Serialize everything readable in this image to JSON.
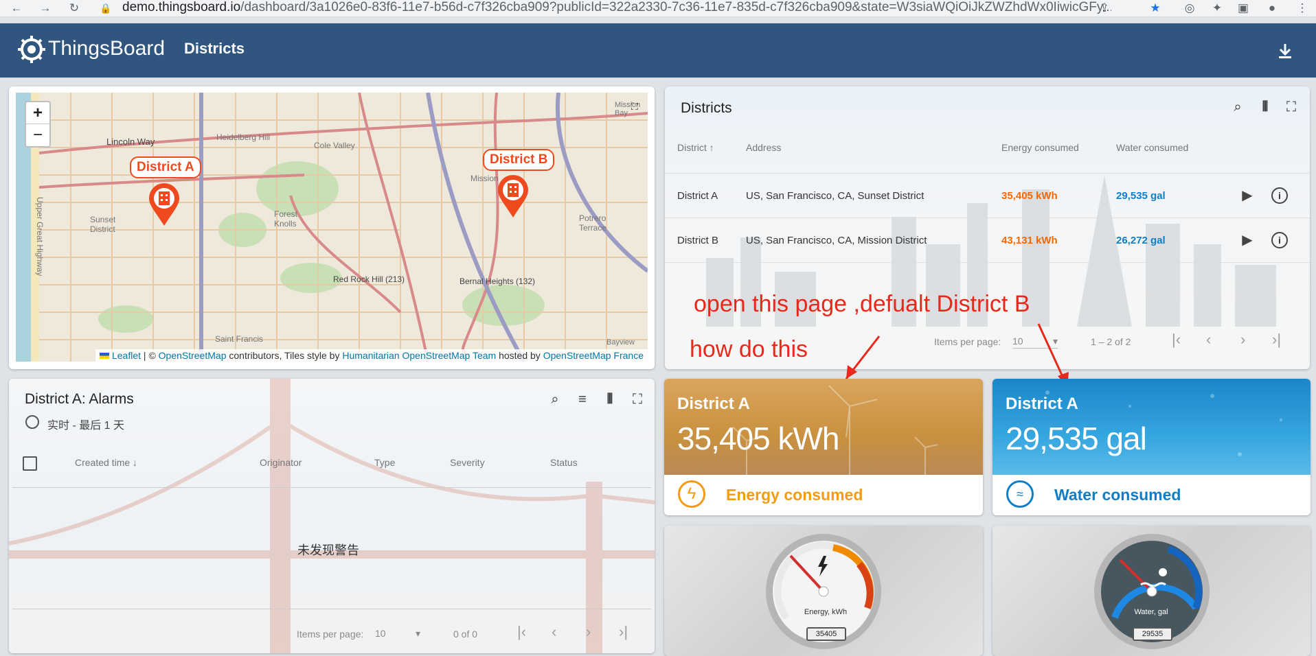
{
  "browser": {
    "url_host": "demo.thingsboard.io",
    "url_path": "/dashboard/3a1026e0-83f6-11e7-b56d-c7f326cba909?publicId=322a2330-7c36-11e7-835d-c7f326cba909&state=W3siaWQiOiJkZWZhdWx0IiwicGFy..."
  },
  "header": {
    "brand": "ThingsBoard",
    "title": "Districts"
  },
  "map": {
    "marker_a": "District A",
    "marker_b": "District B",
    "zoom_in": "+",
    "zoom_out": "−",
    "labels": {
      "lincoln": "Lincoln Way",
      "heidelberg": "Heidelberg Hill",
      "cole": "Cole Valley",
      "forest": "Forest Knolls",
      "sunset": "Sunset District",
      "redrock": "Red Rock Hill (213)",
      "bernal": "Bernal Heights (132)",
      "potrero": "Potrero Terrace",
      "mission": "Mission",
      "saintfrancis": "Saint Francis",
      "upper": "Upper Great Highway",
      "bayview": "Bayview",
      "missionbay": "Mission Bay"
    },
    "attr_leaflet": "Leaflet",
    "attr_sep1": " | © ",
    "attr_osm": "OpenStreetMap",
    "attr_mid": " contributors, Tiles style by ",
    "attr_hot": "Humanitarian OpenStreetMap Team",
    "attr_hosted": " hosted by ",
    "attr_fr": "OpenStreetMap France"
  },
  "districts": {
    "title": "Districts",
    "columns": {
      "district": "District",
      "address": "Address",
      "energy": "Energy consumed",
      "water": "Water consumed"
    },
    "rows": [
      {
        "district": "District A",
        "address": "US, San Francisco, CA, Sunset District",
        "energy": "35,405 kWh",
        "water": "29,535 gal"
      },
      {
        "district": "District B",
        "address": "US, San Francisco, CA, Mission District",
        "energy": "43,131 kWh",
        "water": "26,272 gal"
      }
    ],
    "items_per_page_label": "Items per page:",
    "items_per_page": "10",
    "range": "1 – 2 of 2"
  },
  "annotations": {
    "line1": "open this page  ,defualt District B",
    "line2": "how do this"
  },
  "alarms": {
    "title": "District A: Alarms",
    "timewindow": "实时 - 最后 1 天",
    "columns": {
      "created": "Created time",
      "originator": "Originator",
      "type": "Type",
      "severity": "Severity",
      "status": "Status"
    },
    "empty": "未发现警告",
    "items_per_page_label": "Items per page:",
    "items_per_page": "10",
    "range": "0 of 0"
  },
  "energy_tile": {
    "title": "District A",
    "value": "35,405 kWh",
    "label": "Energy consumed"
  },
  "water_tile": {
    "title": "District A",
    "value": "29,535 gal",
    "label": "Water consumed"
  },
  "energy_gauge": {
    "label": "Energy, kWh",
    "readout": "35405"
  },
  "water_gauge": {
    "label": "Water, gal",
    "readout": "29535"
  },
  "colors": {
    "appbar": "#305680",
    "energy": "#f36900",
    "water": "#0e7ec7",
    "marker": "#ef4a1d"
  }
}
